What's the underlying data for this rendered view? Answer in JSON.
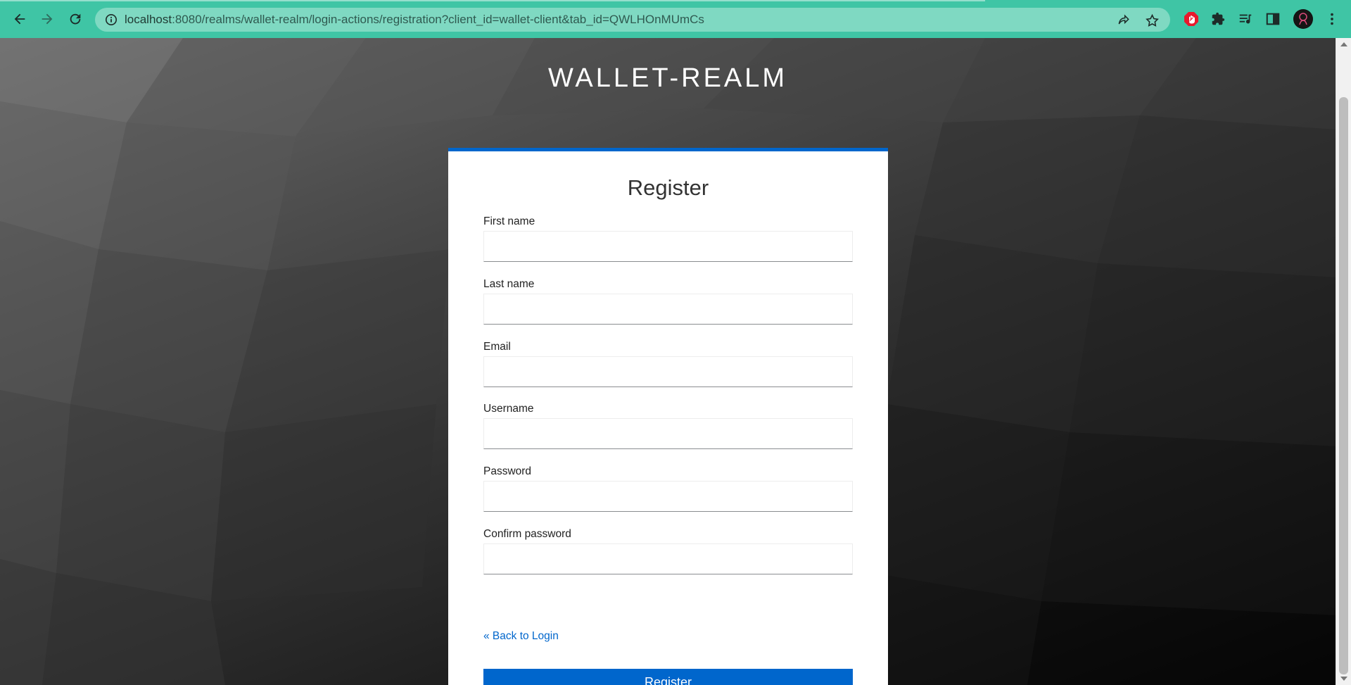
{
  "browser": {
    "url_host": "localhost",
    "url_rest": ":8080/realms/wallet-realm/login-actions/registration?client_id=wallet-client&tab_id=QWLHOnMUmCs"
  },
  "page": {
    "realm_title": "WALLET-REALM",
    "form_title": "Register",
    "fields": [
      {
        "label": "First name",
        "value": ""
      },
      {
        "label": "Last name",
        "value": ""
      },
      {
        "label": "Email",
        "value": ""
      },
      {
        "label": "Username",
        "value": ""
      },
      {
        "label": "Password",
        "value": ""
      },
      {
        "label": "Confirm password",
        "value": ""
      }
    ],
    "back_link": "« Back to Login",
    "submit_label": "Register"
  },
  "colors": {
    "chrome": "#3fc5a5",
    "accent": "#0066cc"
  }
}
